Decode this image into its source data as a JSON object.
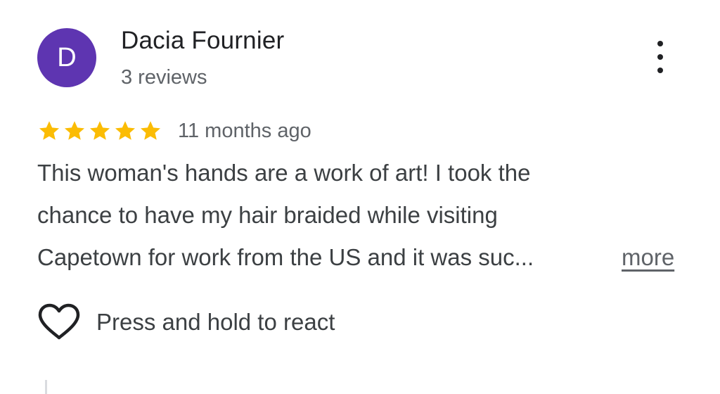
{
  "review": {
    "author": {
      "initial": "D",
      "name": "Dacia Fournier",
      "review_count": "3 reviews",
      "avatar_color": "#5e35b1"
    },
    "menu_icon": "more-vert-icon",
    "rating": {
      "stars": 5,
      "max_stars": 5,
      "star_color": "#fbbc04",
      "star_icon": "star-icon"
    },
    "timestamp": "11 months ago",
    "text_lines": [
      "This woman's hands are a work of art! I took the",
      "chance to have my hair braided while visiting",
      "Capetown for work from the US and it was suc..."
    ],
    "more_label": "more",
    "reaction": {
      "icon": "heart-outline-icon",
      "label": "Press and hold to react"
    }
  }
}
